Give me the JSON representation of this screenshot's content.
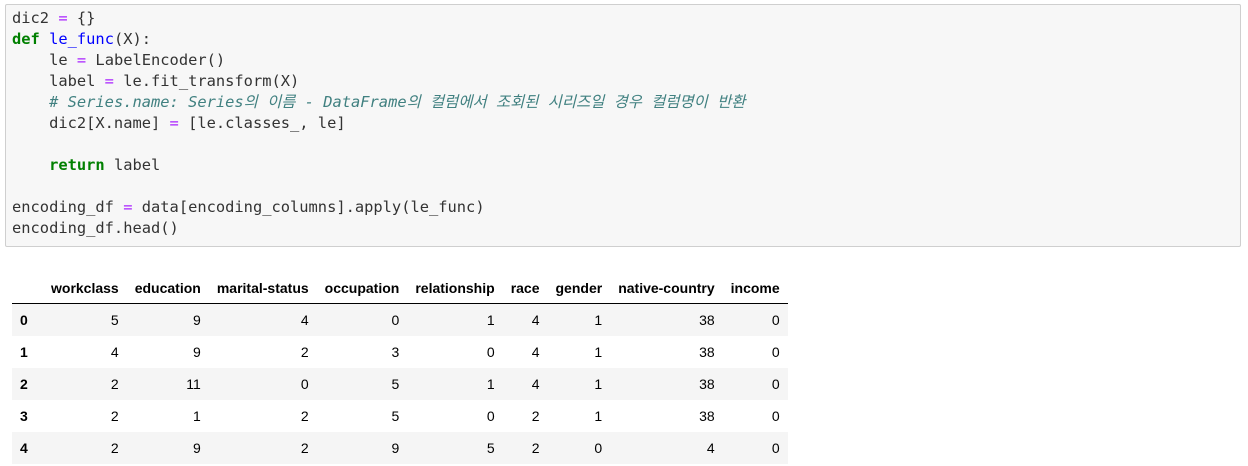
{
  "code_cell": {
    "lines": [
      "dic2 = {}",
      "def le_func(X):",
      "    le = LabelEncoder()",
      "    label = le.fit_transform(X)",
      "    # Series.name: Series의 이름 - DataFrame의 컬럼에서 조회된 시리즈일 경우 컬럼명이 반환",
      "    dic2[X.name] = [le.classes_, le]",
      "",
      "    return label",
      "",
      "encoding_df = data[encoding_columns].apply(le_func)",
      "encoding_df.head()"
    ]
  },
  "output_table": {
    "columns": [
      "",
      "workclass",
      "education",
      "marital-status",
      "occupation",
      "relationship",
      "race",
      "gender",
      "native-country",
      "income"
    ],
    "rows": [
      {
        "index": "0",
        "values": [
          "5",
          "9",
          "4",
          "0",
          "1",
          "4",
          "1",
          "38",
          "0"
        ]
      },
      {
        "index": "1",
        "values": [
          "4",
          "9",
          "2",
          "3",
          "0",
          "4",
          "1",
          "38",
          "0"
        ]
      },
      {
        "index": "2",
        "values": [
          "2",
          "11",
          "0",
          "5",
          "1",
          "4",
          "1",
          "38",
          "0"
        ]
      },
      {
        "index": "3",
        "values": [
          "2",
          "1",
          "2",
          "5",
          "0",
          "2",
          "1",
          "38",
          "0"
        ]
      },
      {
        "index": "4",
        "values": [
          "2",
          "9",
          "2",
          "9",
          "5",
          "2",
          "0",
          "4",
          "0"
        ]
      }
    ]
  },
  "colors": {
    "keyword": "#008000",
    "function_name": "#0000ff",
    "operator": "#aa22ff",
    "comment": "#408080",
    "cell_background": "#f7f7f7",
    "row_stripe": "#f5f5f5"
  }
}
